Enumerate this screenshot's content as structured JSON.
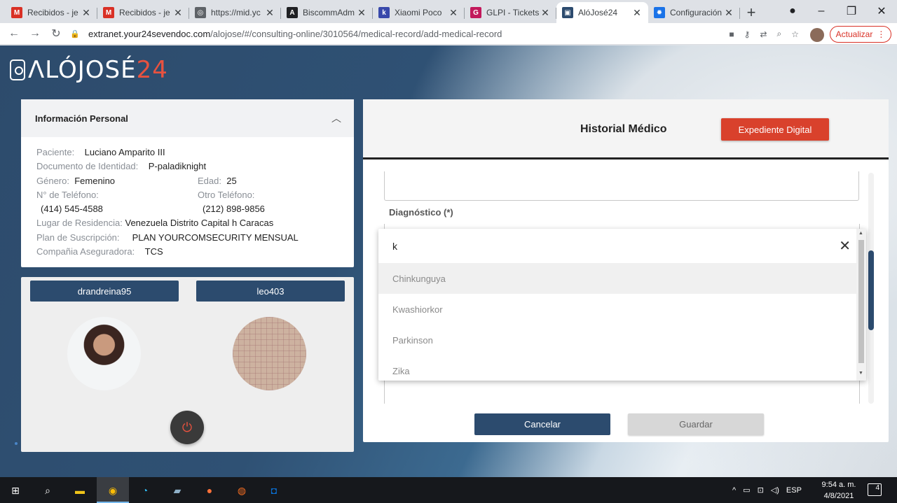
{
  "browser": {
    "tabs": [
      {
        "title": "Recibidos - je",
        "icon": "gmail-icon",
        "color": "#d93025",
        "glyph": "M"
      },
      {
        "title": "Recibidos - je",
        "icon": "gmail-icon",
        "color": "#d93025",
        "glyph": "M"
      },
      {
        "title": "https://mid.yc",
        "icon": "globe-icon",
        "color": "#5f6368",
        "glyph": "◎"
      },
      {
        "title": "BiscommAdm",
        "icon": "angular-icon",
        "color": "#202124",
        "glyph": "A"
      },
      {
        "title": "Xiaomi Poco",
        "icon": "ki-icon",
        "color": "#3949ab",
        "glyph": "k"
      },
      {
        "title": "GLPI - Tickets",
        "icon": "glpi-icon",
        "color": "#c2185b",
        "glyph": "G"
      },
      {
        "title": "AlóJosé24",
        "icon": "alojose-icon",
        "color": "#2c4b6e",
        "glyph": "▣",
        "active": true
      },
      {
        "title": "Configuración",
        "icon": "settings-icon",
        "color": "#1a73e8",
        "glyph": "✹"
      }
    ],
    "url_host": "extranet.your24sevendoc.com",
    "url_path": "/alojose/#/consulting-online/3010564/medical-record/add-medical-record",
    "update_label": "Actualizar"
  },
  "logo": {
    "text_main": "ΛLÓJOSÉ",
    "text_accent": "24"
  },
  "personal_info": {
    "title": "Información Personal",
    "patient_label": "Paciente:",
    "patient_value": "Luciano Amparito III",
    "doc_label": "Documento de Identidad:",
    "doc_value": "P-paladiknight",
    "gender_label": "Género:",
    "gender_value": "Femenino",
    "age_label": "Edad:",
    "age_value": "25",
    "phone_label": "N° de Teléfono:",
    "phone_value": "(414) 545-4588",
    "other_phone_label": "Otro Teléfono:",
    "other_phone_value": "(212) 898-9856",
    "residence_label": "Lugar de Residencia:",
    "residence_value": "Venezuela Distrito Capital h Caracas",
    "plan_label": "Plan de Suscripción:",
    "plan_value": "PLAN YOURCOMSECURITY MENSUAL",
    "insurer_label": "Compañia Aseguradora:",
    "insurer_value": "TCS"
  },
  "call": {
    "user_left": "drandreina95",
    "user_right": "leo403"
  },
  "medical": {
    "title": "Historial Médico",
    "digital_record_label": "Expediente Digital",
    "diagnosis_label": "Diagnóstico (*)",
    "cancel_label": "Cancelar",
    "save_label": "Guardar"
  },
  "dropdown": {
    "search_value": "k",
    "options": [
      "Chinkunguya",
      "Kwashiorkor",
      "Parkinson",
      "Zika"
    ]
  },
  "taskbar": {
    "language": "ESP",
    "time": "9:54 a. m.",
    "date": "4/8/2021",
    "notifications": "4"
  }
}
